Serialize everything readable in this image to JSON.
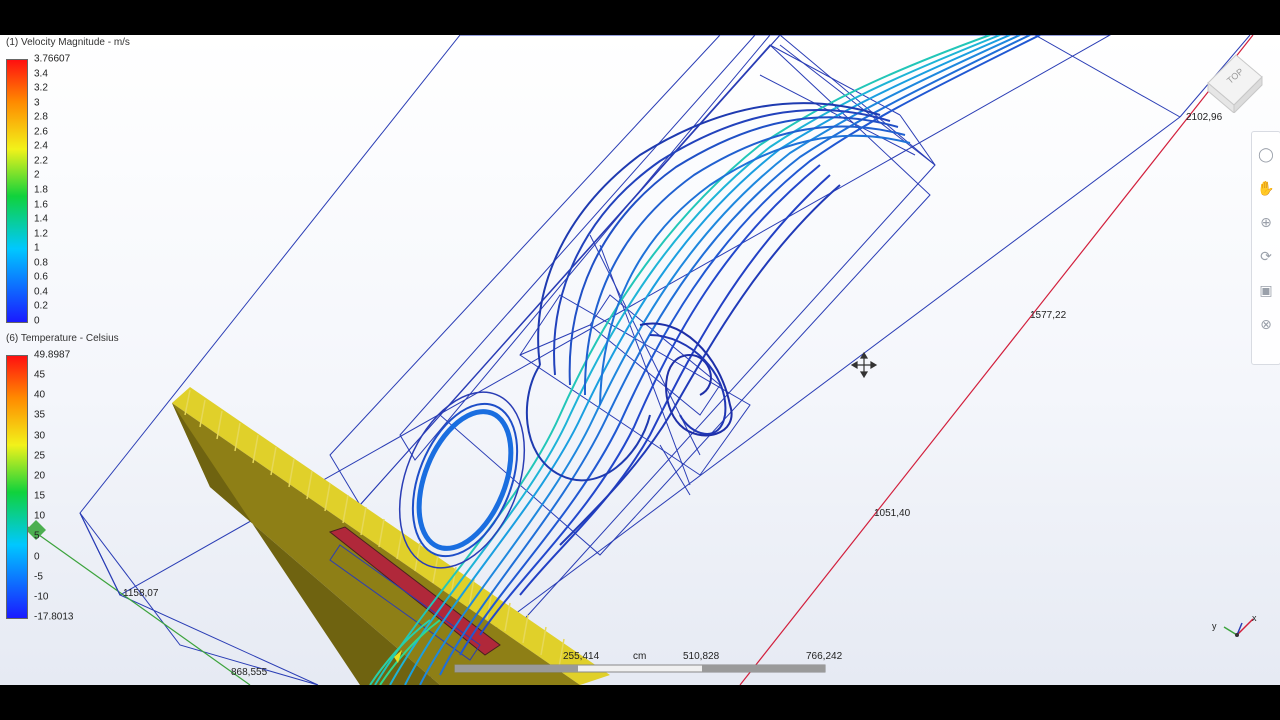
{
  "legend_velocity": {
    "title": "(1) Velocity Magnitude - m/s",
    "ticks": [
      "3.76607",
      "3.4",
      "3.2",
      "3",
      "2.8",
      "2.6",
      "2.4",
      "2.2",
      "2",
      "1.8",
      "1.6",
      "1.4",
      "1.2",
      "1",
      "0.8",
      "0.6",
      "0.4",
      "0.2",
      "0"
    ]
  },
  "legend_temperature": {
    "title": "(6) Temperature - Celsius",
    "ticks": [
      "49.8987",
      "45",
      "40",
      "35",
      "30",
      "25",
      "20",
      "15",
      "10",
      "5",
      "0",
      "-5",
      "-10",
      "-17.8013"
    ]
  },
  "dimensions": {
    "d1": "2102,96",
    "d2": "1577,22",
    "d3": "1051,40",
    "d4": "1158,07",
    "d5": "868,555"
  },
  "ruler": {
    "v1": "255,414",
    "unit": "cm",
    "v2": "510,828",
    "v3": "766,242"
  },
  "viewcube": {
    "face_label": "TOP"
  },
  "navbar": {
    "icons": [
      "steering-wheel-icon",
      "pan-hand-icon",
      "zoom-icon",
      "orbit-icon",
      "look-at-icon",
      "fit-view-icon"
    ]
  },
  "triad": {
    "x": "x",
    "y": "y"
  },
  "colors": {
    "accent_red": "#d21f3c",
    "axis_green": "#3ca33c",
    "wire_blue": "#2a3db5"
  }
}
